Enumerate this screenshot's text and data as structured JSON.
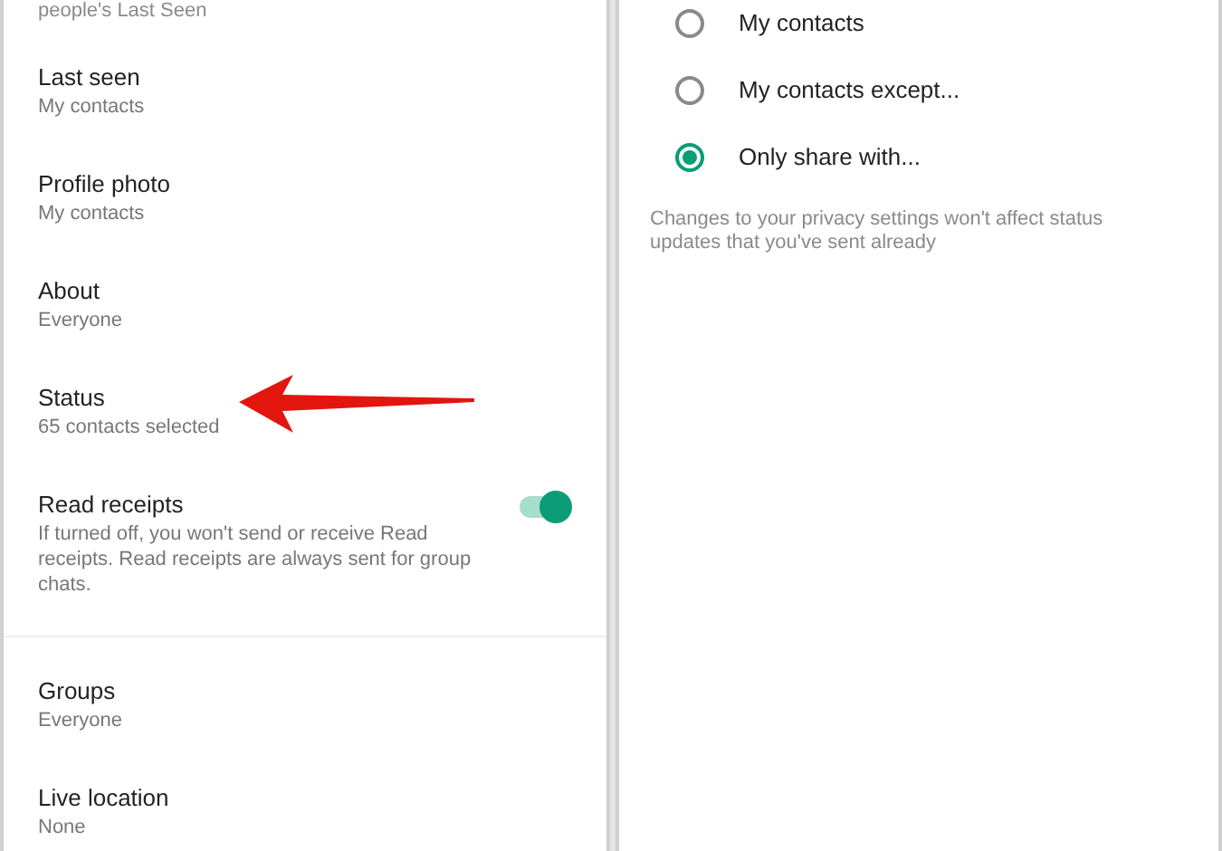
{
  "privacy_settings": {
    "top_hint": "people's Last Seen",
    "items": [
      {
        "kind": "option",
        "title": "Last seen",
        "value": "My contacts"
      },
      {
        "kind": "option",
        "title": "Profile photo",
        "value": "My contacts"
      },
      {
        "kind": "option",
        "title": "About",
        "value": "Everyone"
      },
      {
        "kind": "option",
        "title": "Status",
        "value": "65 contacts selected"
      },
      {
        "kind": "toggle",
        "title": "Read receipts",
        "value": "If turned off, you won't send or receive Read receipts. Read receipts are always sent for group chats.",
        "on": true
      },
      {
        "kind": "divider"
      },
      {
        "kind": "option",
        "title": "Groups",
        "value": "Everyone"
      },
      {
        "kind": "option",
        "title": "Live location",
        "value": "None"
      }
    ]
  },
  "status_privacy": {
    "options": [
      {
        "label": "My contacts",
        "selected": false
      },
      {
        "label": "My contacts except...",
        "selected": false
      },
      {
        "label": "Only share with...",
        "selected": true
      }
    ],
    "note": "Changes to your privacy settings won't affect status updates that you've sent already"
  }
}
